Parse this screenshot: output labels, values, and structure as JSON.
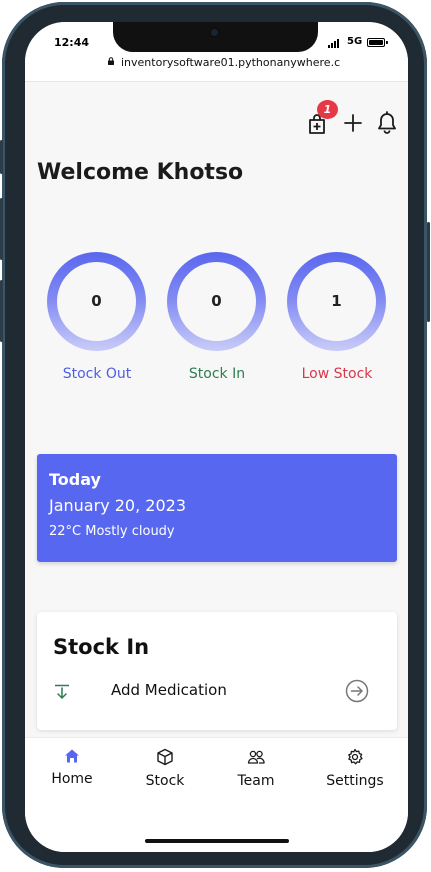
{
  "status_bar": {
    "time": "12:44",
    "network": "5G"
  },
  "browser": {
    "url": "inventorysoftware01.pythonanywhere.c"
  },
  "header": {
    "cart_badge_count": "1"
  },
  "welcome": {
    "text": "Welcome Khotso"
  },
  "stats": [
    {
      "value": "0",
      "label": "Stock Out",
      "color": "#4f5fe0"
    },
    {
      "value": "0",
      "label": "Stock In",
      "color": "#2e7d4f"
    },
    {
      "value": "1",
      "label": "Low Stock",
      "color": "#d9384a"
    }
  ],
  "today": {
    "title": "Today",
    "date": "January 20, 2023",
    "weather": "22°C Mostly cloudy"
  },
  "stock_in_card": {
    "title": "Stock In",
    "action_label": "Add Medication"
  },
  "tabs": [
    {
      "label": "Home",
      "icon": "home-icon"
    },
    {
      "label": "Stock",
      "icon": "box-icon"
    },
    {
      "label": "Team",
      "icon": "team-icon"
    },
    {
      "label": "Settings",
      "icon": "gear-icon"
    }
  ],
  "colors": {
    "accent": "#5867f0",
    "badge": "#e53946"
  }
}
